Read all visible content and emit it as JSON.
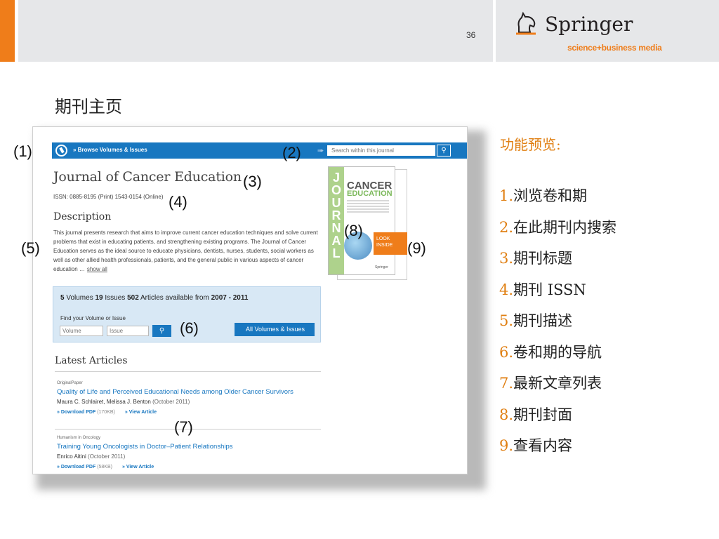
{
  "header": {
    "page_number": "36",
    "logo_name": "Springer",
    "logo_tagline": "science+business media",
    "accent_color": "#ef7d1a",
    "bar_color": "#e6e7e9"
  },
  "slide_title": "期刊主页",
  "screenshot": {
    "topbar": {
      "browse_link": "» Browse Volumes & Issues",
      "search_placeholder": "Search within this journal",
      "color": "#1877c0"
    },
    "journal_title": "Journal of Cancer Education",
    "issn": "ISSN: 0885-8195 (Print) 1543-0154 (Online)",
    "description_heading": "Description",
    "description_text": "This journal presents research that aims to improve current cancer education techniques and solve current problems that exist in educating patients, and strengthening existing programs. The Journal of Cancer Education serves as the ideal source to educate physicians, dentists, nurses, students, social workers as well as other allied health professionals, patients, and the general public in various aspects of cancer education …",
    "show_all": "show all",
    "cover": {
      "journal_word": "JOURNAL",
      "cancer_word": "CANCER",
      "education_word": "EDUCATION",
      "publisher": "Springer",
      "look_inside": "LOOK INSIDE"
    },
    "volumes_box": {
      "volumes_count": "5",
      "volumes_label": "Volumes",
      "issues_count": "19",
      "issues_label": "Issues",
      "articles_count": "502",
      "articles_label": "Articles available from",
      "year_from": "2007",
      "year_sep": "-",
      "year_to": "2011",
      "find_label": "Find your Volume or Issue",
      "volume_placeholder": "Volume",
      "issue_placeholder": "Issue",
      "all_button": "All Volumes & Issues"
    },
    "latest_heading": "Latest Articles",
    "articles": [
      {
        "type": "OriginalPaper",
        "title": "Quality of Life and Perceived Educational Needs among Older Cancer Survivors",
        "authors": "Maura C. Schlairet, Melissa J. Benton",
        "date": "(October 2011)",
        "pdf_label": "» Download PDF",
        "pdf_size": "(170KB)",
        "view_label": "» View Article"
      },
      {
        "type": "Humanism in Oncology",
        "title": "Training Young Oncologists in Doctor–Patient Relationships",
        "authors": "Enrico Aitini",
        "date": "(October 2011)",
        "pdf_label": "» Download PDF",
        "pdf_size": "(58KB)",
        "view_label": "» View Article"
      }
    ]
  },
  "callouts": [
    "(1)",
    "(2)",
    "(3)",
    "(4)",
    "(5)",
    "(6)",
    "(7)",
    "(8)",
    "(9)"
  ],
  "features": {
    "title": "功能预览:",
    "items": [
      {
        "num": "1.",
        "text": "浏览卷和期"
      },
      {
        "num": "2.",
        "text": "在此期刊内搜索"
      },
      {
        "num": "3.",
        "text": "期刊标题"
      },
      {
        "num": "4.",
        "text": "期刊 ISSN"
      },
      {
        "num": "5.",
        "text": "期刊描述"
      },
      {
        "num": "6.",
        "text": "卷和期的导航"
      },
      {
        "num": "7.",
        "text": "最新文章列表"
      },
      {
        "num": "8.",
        "text": "期刊封面"
      },
      {
        "num": "9.",
        "text": "查看内容"
      }
    ],
    "number_color": "#e07f12"
  }
}
